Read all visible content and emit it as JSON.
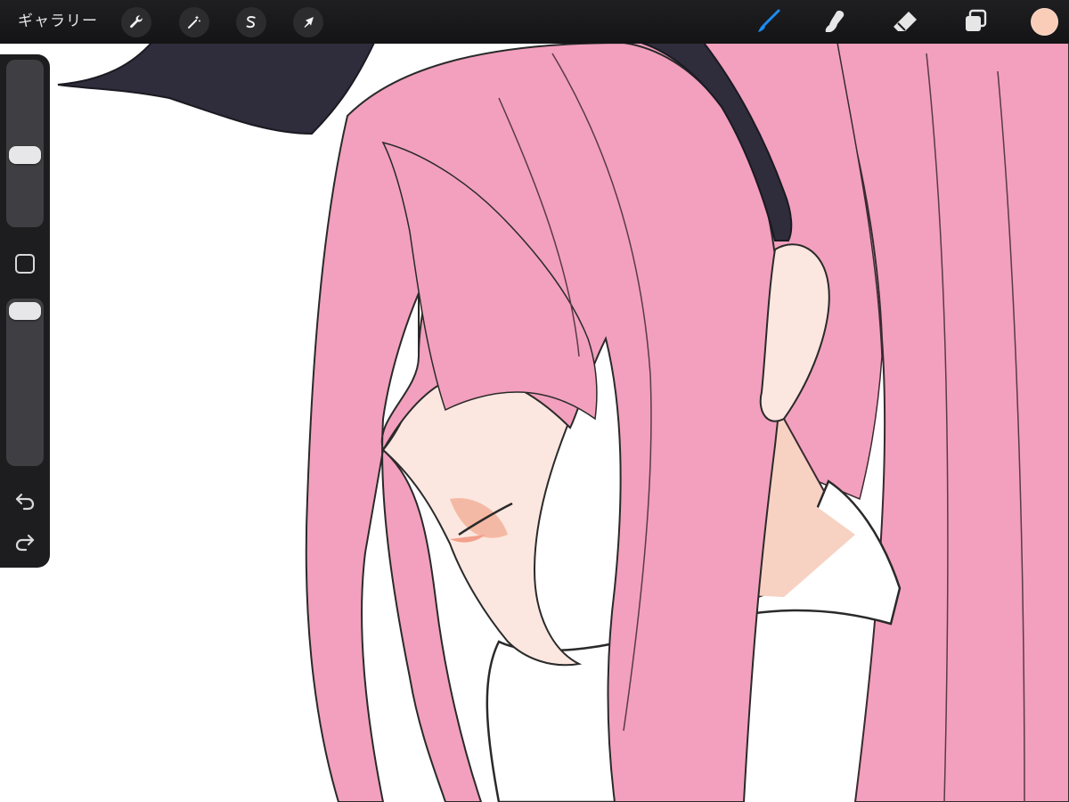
{
  "app": {
    "gallery_label": "ギャラリー"
  },
  "toolbar": {
    "left_tools": [
      {
        "name": "actions",
        "icon": "wrench-icon"
      },
      {
        "name": "adjustments",
        "icon": "magic-wand-icon"
      },
      {
        "name": "selection",
        "icon": "selection-s-icon"
      },
      {
        "name": "transform",
        "icon": "arrow-cursor-icon"
      }
    ],
    "right_tools": [
      {
        "name": "brush",
        "icon": "brush-icon",
        "active": true
      },
      {
        "name": "smudge",
        "icon": "smudge-finger-icon",
        "active": false
      },
      {
        "name": "eraser",
        "icon": "eraser-icon",
        "active": false
      },
      {
        "name": "layers",
        "icon": "layers-icon",
        "active": false
      }
    ],
    "current_color": "#f9cdb7",
    "active_color": "#1d8cf0"
  },
  "sidebar": {
    "brush_size_level": 0.58,
    "opacity_level": 0.0,
    "modify_button_icon": "square-icon",
    "undo_icon": "undo-arrow-icon",
    "redo_icon": "redo-arrow-icon"
  },
  "artwork": {
    "hair_color": "#f2a0bd",
    "skin_color": "#f9ddd2",
    "ribbon_color": "#2f2d3b",
    "eye_color": "#f0b73c"
  }
}
